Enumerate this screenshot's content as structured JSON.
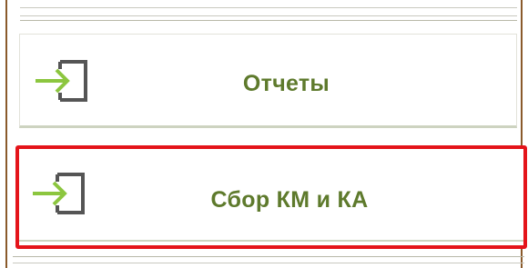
{
  "menu": {
    "items": [
      {
        "label": "Отчеты",
        "icon": "login-arrow-icon"
      },
      {
        "label": "Сбор КМ и КА",
        "icon": "login-arrow-icon",
        "highlighted": true
      }
    ]
  },
  "colors": {
    "label_text": "#5e7a2c",
    "icon_arrow": "#8cc63f",
    "icon_frame": "#555555",
    "highlight_border": "#e4141a",
    "frame_border": "#8a5a2b"
  }
}
